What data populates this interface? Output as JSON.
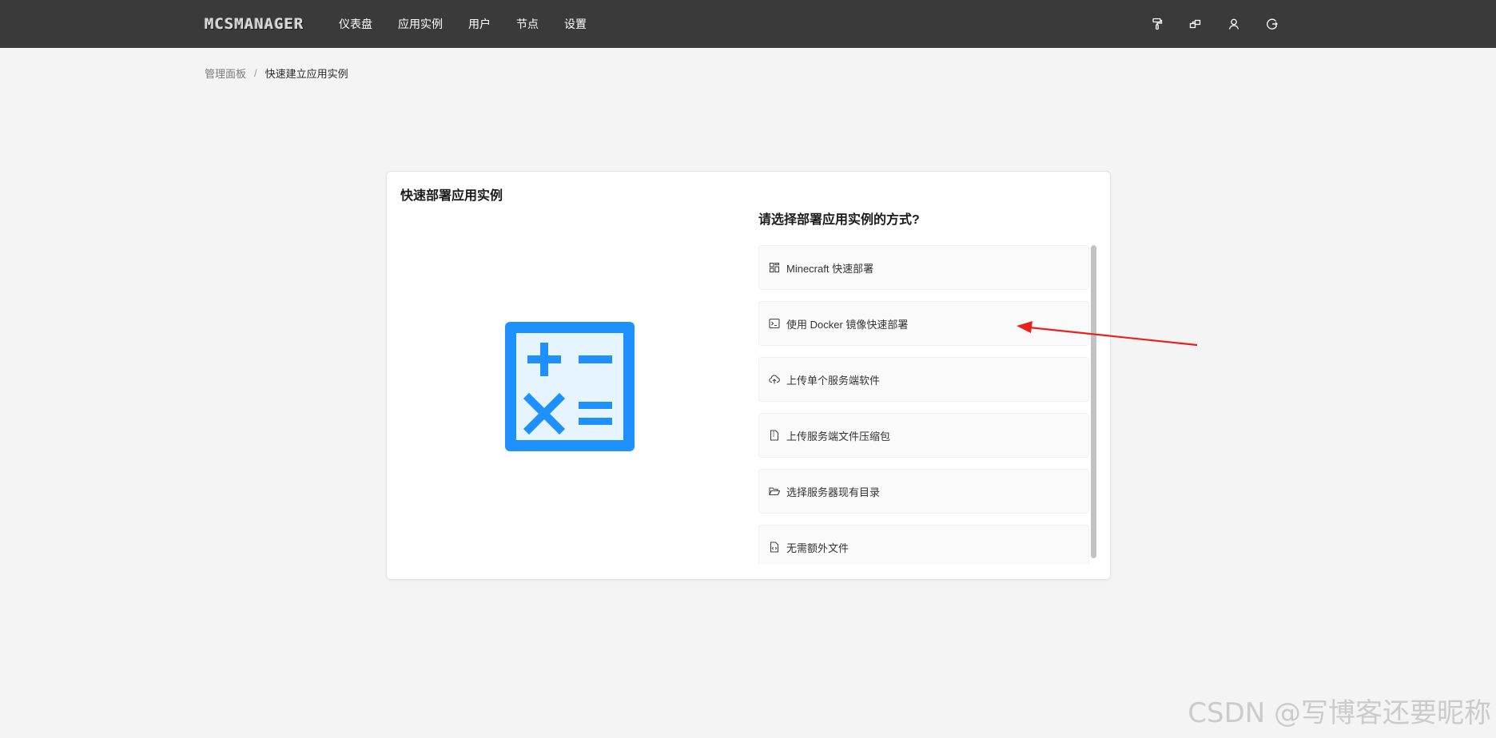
{
  "app": {
    "logo_text": "MCSMANAGER"
  },
  "nav": {
    "items": [
      "仪表盘",
      "应用实例",
      "用户",
      "节点",
      "设置"
    ]
  },
  "top_icons": [
    "paint-roller-icon",
    "nodes-icon",
    "user-icon",
    "logout-icon"
  ],
  "breadcrumb": {
    "parent": "管理面板",
    "separator": "/",
    "current": "快速建立应用实例"
  },
  "card": {
    "title": "快速部署应用实例",
    "question": "请选择部署应用实例的方式?",
    "options": [
      {
        "label": "Minecraft 快速部署",
        "icon": "app-grid-icon"
      },
      {
        "label": "使用 Docker 镜像快速部署",
        "icon": "terminal-icon"
      },
      {
        "label": "上传单个服务端软件",
        "icon": "cloud-upload-icon"
      },
      {
        "label": "上传服务端文件压缩包",
        "icon": "file-zip-icon"
      },
      {
        "label": "选择服务器现有目录",
        "icon": "folder-open-icon"
      },
      {
        "label": "无需额外文件",
        "icon": "file-code-icon"
      }
    ],
    "illustration": "calculator-icon"
  },
  "colors": {
    "topbar": "#3a3a3a",
    "accent": "#1e90ff",
    "annotation_arrow": "#e8231c"
  },
  "watermark": "CSDN @写博客还要昵称"
}
